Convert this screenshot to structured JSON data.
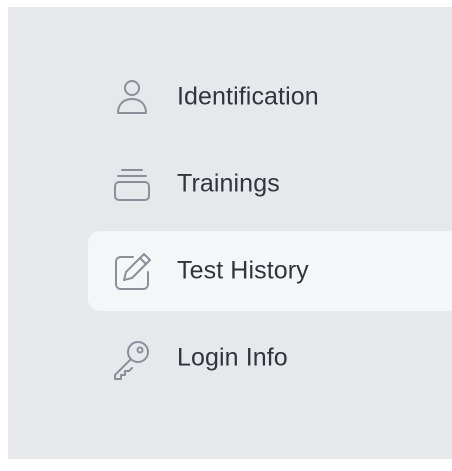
{
  "sidebar": {
    "items": [
      {
        "label": "Identification",
        "icon": "user-icon",
        "active": false
      },
      {
        "label": "Trainings",
        "icon": "archive-tray-icon",
        "active": false
      },
      {
        "label": "Test History",
        "icon": "edit-pencil-icon",
        "active": true
      },
      {
        "label": "Login Info",
        "icon": "key-icon",
        "active": false
      }
    ]
  },
  "colors": {
    "sidebar_background": "#e6e8ec",
    "active_item_background": "#f5f6f7",
    "label_text": "#2f343d",
    "icon_stroke": "#8a8f99"
  }
}
